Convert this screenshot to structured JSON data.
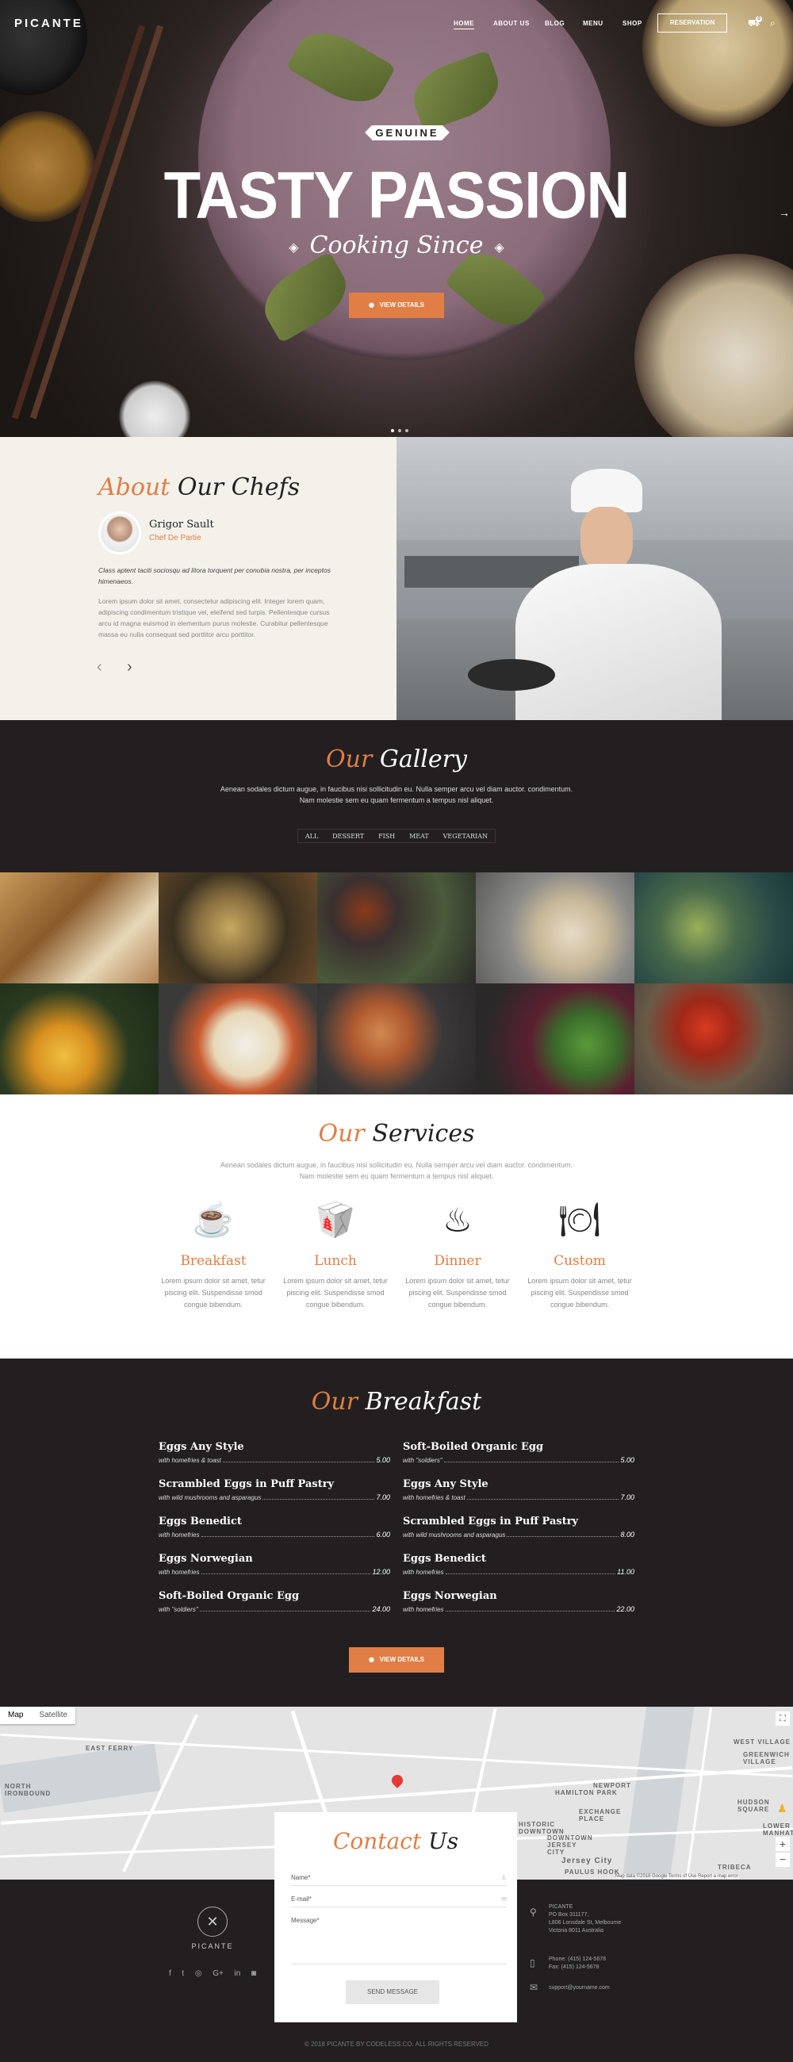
{
  "nav": {
    "logo": "PICANTE",
    "links": [
      "HOME",
      "ABOUT US",
      "BLOG",
      "MENU",
      "SHOP"
    ],
    "reservation": "RESERVATION",
    "cart_count": "0"
  },
  "hero": {
    "badge": "GENUINE",
    "title": "TASTY PASSION",
    "subtitle": "Cooking Since",
    "button": "VIEW DETAILS"
  },
  "about": {
    "title_accent": "About",
    "title_rest": "Our Chefs",
    "chef_name": "Grigor Sault",
    "chef_role": "Chef De Partie",
    "lead": "Class aptent taciti sociosqu ad litora torquent per conubia nostra, per inceptos himenaeos.",
    "body": "Lorem ipsum dolor sit amet, consectetur adipiscing elit. Integer lorem quam, adipiscing condimentum tristique vel, eleifend sed turpis. Pellentesque cursus arcu id magna euismod in elementum purus molestie. Curabitur pellentesque massa eu nulla consequat sed porttitor arcu porttitor."
  },
  "gallery": {
    "title_accent": "Our",
    "title_rest": "Gallery",
    "text1": "Aenean sodales dictum augue, in faucibus nisi sollicitudin eu. Nulla semper arcu vel diam auctor. condimentum.",
    "text2": "Nam molestie sem eu quam fermentum a tempus nisl aliquet.",
    "filters": [
      "ALL",
      "DESSERT",
      "FISH",
      "MEAT",
      "VEGETARIAN"
    ]
  },
  "services": {
    "title_accent": "Our",
    "title_rest": "Services",
    "text1": "Aenean sodales dictum augue, in faucibus nisi sollicitudin eu. Nulla semper arcu vel diam auctor. condimentum.",
    "text2": "Nam molestie sem eu quam fermentum a tempus nisl aliquet.",
    "items": [
      {
        "name": "Breakfast",
        "text": "Lorem ipsum dolor sit amet, tetur piscing elit. Suspendisse smod congue bibendum."
      },
      {
        "name": "Lunch",
        "text": "Lorem ipsum dolor sit amet, tetur piscing elit. Suspendisse smod congue bibendum."
      },
      {
        "name": "Dinner",
        "text": "Lorem ipsum dolor sit amet, tetur piscing elit. Suspendisse smod congue bibendum."
      },
      {
        "name": "Custom",
        "text": "Lorem ipsum dolor sit amet, tetur piscing elit. Suspendisse smod congue bibendum."
      }
    ]
  },
  "menu": {
    "title_accent": "Our",
    "title_rest": "Breakfast",
    "left": [
      {
        "name": "Eggs Any Style",
        "desc": "with homefries & toast",
        "price": "5.00"
      },
      {
        "name": "Scrambled Eggs in Puff Pastry",
        "desc": "with wild mushrooms and asparagus",
        "price": "7.00"
      },
      {
        "name": "Eggs Benedict",
        "desc": "with homefries",
        "price": "6.00"
      },
      {
        "name": "Eggs Norwegian",
        "desc": "with homefries",
        "price": "12.00"
      },
      {
        "name": "Soft-Boiled Organic Egg",
        "desc": "with \"soldiers\"",
        "price": "24.00"
      }
    ],
    "right": [
      {
        "name": "Soft-Boiled Organic Egg",
        "desc": "with \"soldiers\"",
        "price": "5.00"
      },
      {
        "name": "Eggs Any Style",
        "desc": "with homefries & toast",
        "price": "7.00"
      },
      {
        "name": "Scrambled Eggs in Puff Pastry",
        "desc": "with wild mushrooms and asparagus",
        "price": "8.00"
      },
      {
        "name": "Eggs Benedict",
        "desc": "with homefries",
        "price": "11.00"
      },
      {
        "name": "Eggs Norwegian",
        "desc": "with homefries",
        "price": "22.00"
      }
    ],
    "button": "VIEW DETAILS"
  },
  "map": {
    "tabs": [
      "Map",
      "Satellite"
    ],
    "labels": [
      "EAST FERRY",
      "NORTH IRONBOUND",
      "HAMILTON PARK",
      "NEWPORT",
      "HISTORIC DOWNTOWN",
      "DOWNTOWN JERSEY CITY",
      "Jersey City",
      "PAULUS HOOK",
      "WEST VILLAGE",
      "GREENWICH VILLAGE",
      "HUDSON SQUARE",
      "LOWER MANHATTAN",
      "TRIBECA",
      "EXCHANGE PLACE"
    ],
    "footer_note": "Map data ©2018 Google   Terms of Use   Report a map error"
  },
  "footer": {
    "logo": "PICANTE",
    "social": [
      "f",
      "t",
      "◎",
      "G+",
      "in",
      "◙"
    ],
    "address": [
      "PICANTE",
      "PO Box 311177,",
      "L806 Lonsdale St, Melbourne",
      "Victoria 8011 Australia"
    ],
    "phones": [
      "Phone: (415) 124-5678",
      "Fax: (415) 124-5678"
    ],
    "email": "support@yourname.com",
    "copyright": "© 2018 PICANTE BY CODELESS.CO. ALL RIGHTS RESERVED"
  },
  "contact": {
    "title_accent": "Contact",
    "title_rest": "Us",
    "name_label": "Name*",
    "email_label": "E-mail*",
    "message_label": "Message*",
    "button": "SEND MESSAGE"
  },
  "colors": {
    "accent": "#e07e45",
    "dark": "#231f20",
    "cream": "#f4f1ea"
  }
}
